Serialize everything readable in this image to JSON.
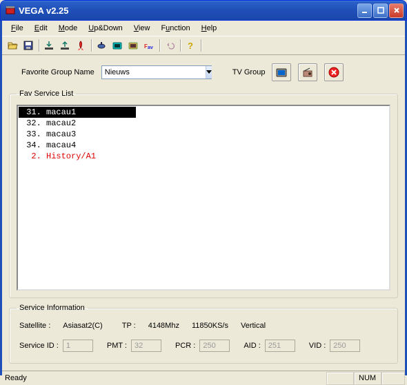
{
  "window": {
    "title": "VEGA v2.25"
  },
  "menu": {
    "file": "File",
    "edit": "Edit",
    "mode": "Mode",
    "updown": "Up&Down",
    "view": "View",
    "function": "Function",
    "help": "Help"
  },
  "toprow": {
    "fav_group_label": "Favorite Group Name",
    "fav_group_value": "Nieuws",
    "tv_group_label": "TV Group"
  },
  "fav_service_list": {
    "legend": "Fav Service List",
    "items": [
      {
        "text": " 31. macau1",
        "selected": true,
        "red": false
      },
      {
        "text": " 32. macau2",
        "selected": false,
        "red": false
      },
      {
        "text": " 33. macau3",
        "selected": false,
        "red": false
      },
      {
        "text": " 34. macau4",
        "selected": false,
        "red": false
      },
      {
        "text": "  2. History/A1",
        "selected": false,
        "red": true
      }
    ]
  },
  "service_info": {
    "legend": "Service Information",
    "satellite_label": "Satellite :",
    "satellite_value": "Asiasat2(C)",
    "tp_label": "TP :",
    "tp_freq": "4148Mhz",
    "tp_symrate": "11850KS/s",
    "tp_pol": "Vertical",
    "service_id_label": "Service ID :",
    "service_id_value": "1",
    "pmt_label": "PMT :",
    "pmt_value": "32",
    "pcr_label": "PCR :",
    "pcr_value": "250",
    "aid_label": "AID :",
    "aid_value": "251",
    "vid_label": "VID :",
    "vid_value": "250"
  },
  "statusbar": {
    "ready": "Ready",
    "num": "NUM"
  }
}
